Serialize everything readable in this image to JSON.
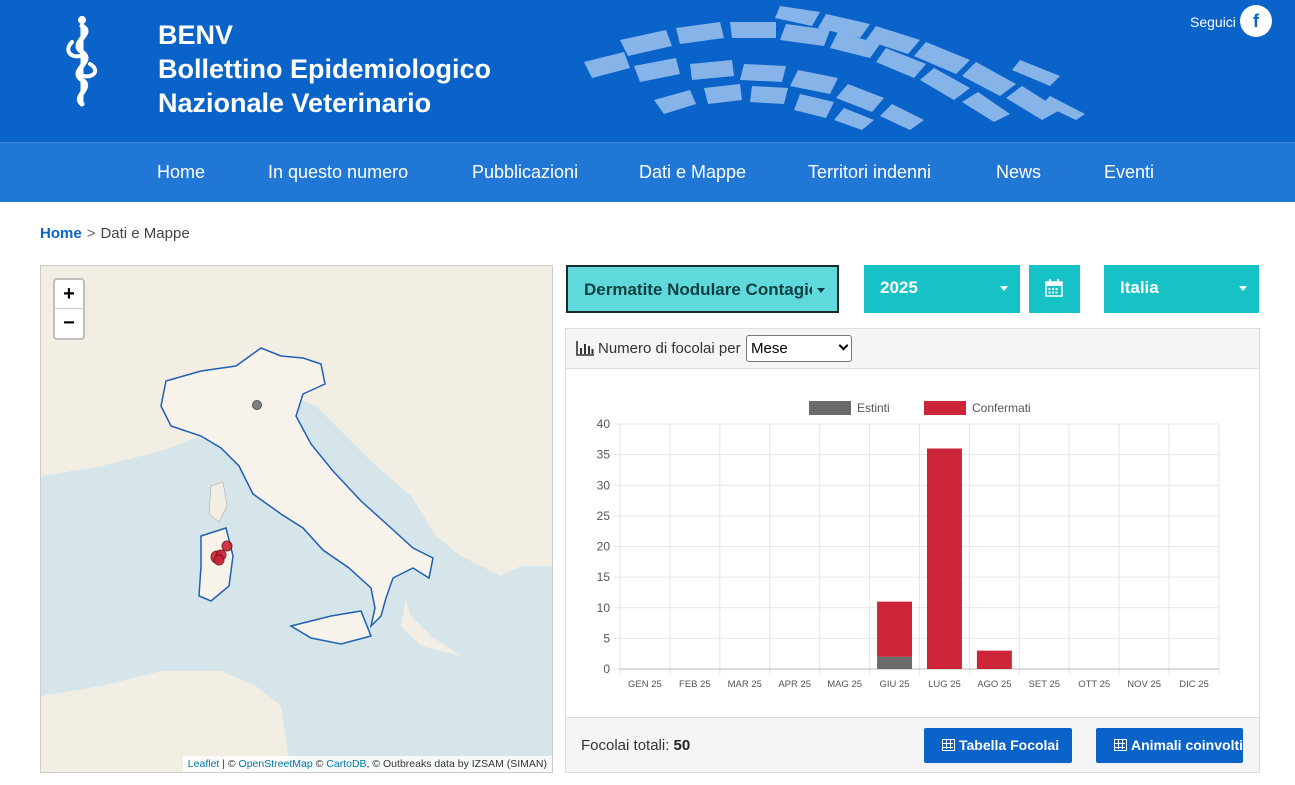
{
  "header": {
    "brand_line1": "BENV",
    "brand_line2": "Bollettino Epidemiologico",
    "brand_line3": "Nazionale Veterinario",
    "follow_label": "Seguici",
    "facebook_glyph": "f",
    "logo_icon": "caduceus-icon",
    "colors": {
      "header_bg": "#0a63c9",
      "nav_bg": "#2177d6"
    }
  },
  "nav": {
    "items": [
      {
        "label": "Home"
      },
      {
        "label": "In questo numero"
      },
      {
        "label": "Pubblicazioni"
      },
      {
        "label": "Dati e Mappe"
      },
      {
        "label": "Territori indenni"
      },
      {
        "label": "News"
      },
      {
        "label": "Eventi"
      }
    ]
  },
  "breadcrumb": {
    "home": "Home",
    "separator": ">",
    "current": "Dati e Mappe"
  },
  "map": {
    "zoom_in": "+",
    "zoom_out": "−",
    "attrib_leaflet": "Leaflet",
    "attrib_sep1": " | © ",
    "attrib_osm": "OpenStreetMap",
    "attrib_sep2": " © ",
    "attrib_carto": "CartoDB",
    "attrib_rest": ", © Outbreaks data by IZSAM (SIMAN)"
  },
  "filters": {
    "disease": "Dermatite Nodulare Contagiosa",
    "year": "2025",
    "calendar_icon": "calendar-icon",
    "region": "Italia",
    "accent_color": "#17c2c6"
  },
  "panel": {
    "title_prefix": "Numero di focolai per",
    "group_by": "Mese",
    "total_label": "Focolai totali:",
    "total_value": "50",
    "button_table": "Tabella Focolai",
    "button_animals": "Animali coinvolti"
  },
  "chart_data": {
    "type": "bar",
    "stacked": true,
    "categories": [
      "GEN 25",
      "FEB 25",
      "MAR 25",
      "APR 25",
      "MAG 25",
      "GIU 25",
      "LUG 25",
      "AGO 25",
      "SET 25",
      "OTT 25",
      "NOV 25",
      "DIC 25"
    ],
    "series": [
      {
        "name": "Estinti",
        "color": "#6b6b6b",
        "values": [
          0,
          0,
          0,
          0,
          0,
          2,
          0,
          0,
          0,
          0,
          0,
          0
        ]
      },
      {
        "name": "Confermati",
        "color": "#cc2439",
        "values": [
          0,
          0,
          0,
          0,
          0,
          9,
          36,
          3,
          0,
          0,
          0,
          0
        ]
      }
    ],
    "yticks": [
      0,
      5,
      10,
      15,
      20,
      25,
      30,
      35,
      40
    ],
    "ylim": [
      0,
      40
    ],
    "legend": "top",
    "grid": true
  }
}
